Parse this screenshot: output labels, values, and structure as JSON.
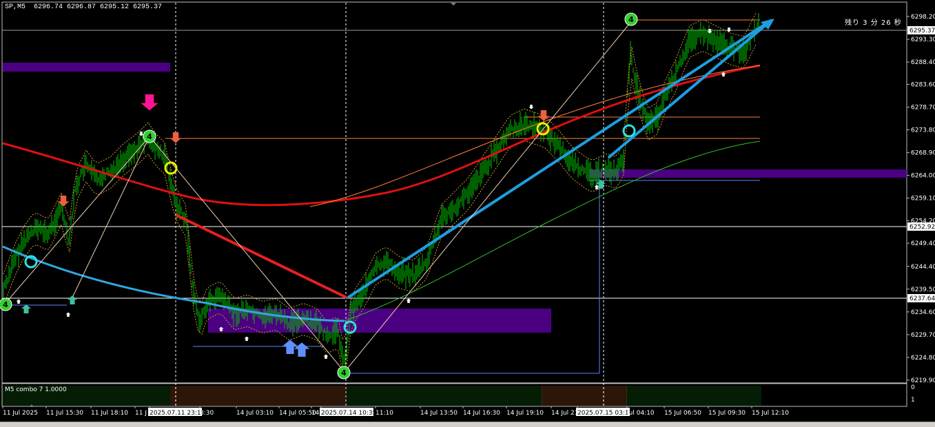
{
  "window": {
    "symbol_timeframe": "SP,M5",
    "ohlc": "6296.74 6296.87 6295.12 6295.37",
    "countdown": "残り 3 分 26 秒"
  },
  "price_axis": {
    "ticks": [
      "6298.20",
      "6293.30",
      "6288.40",
      "6283.60",
      "6278.70",
      "6273.80",
      "6268.90",
      "6264.00",
      "6259.10",
      "6254.20",
      "6249.40",
      "6244.40",
      "6239.50",
      "6234.60",
      "6229.70",
      "6224.80",
      "6219.90"
    ],
    "bid_label": "6295.37",
    "level_labels": [
      "6252.92",
      "6237.64"
    ],
    "range": [
      6219.9,
      6298.2
    ]
  },
  "time_axis": {
    "labels": [
      "11 Jul 2025",
      "11 Jul 15:30",
      "11 Jul 18:10",
      "11 J",
      "2025.07.11 23:15",
      "3:30",
      "14 Jul 03:10",
      "14 Jul 05:50",
      "14",
      "2025.07.14 10:35",
      "11:10",
      "14 Jul 13:50",
      "14 Jul 16:30",
      "14 Jul 19:10",
      "14 Jul 21:50",
      "2025.07.15 03:10",
      "Jul 04:10",
      "15 Jul 06:50",
      "15 Jul 09:30",
      "15 Jul 12:10"
    ]
  },
  "subwindow": {
    "indicator": "M5 combo 7  1.0000",
    "scale": [
      "1",
      "0"
    ]
  },
  "markers": {
    "circle_4_label": "4"
  },
  "colors": {
    "background": "#000000",
    "candles": "#00c000",
    "ma_red": "#e01010",
    "ma_blue": "#30a8e0",
    "trendline": "#1e9ee0",
    "zone": "#4b0082",
    "arrow_down": "#f06040",
    "arrow_pink": "#ff1493"
  },
  "tabs": []
}
